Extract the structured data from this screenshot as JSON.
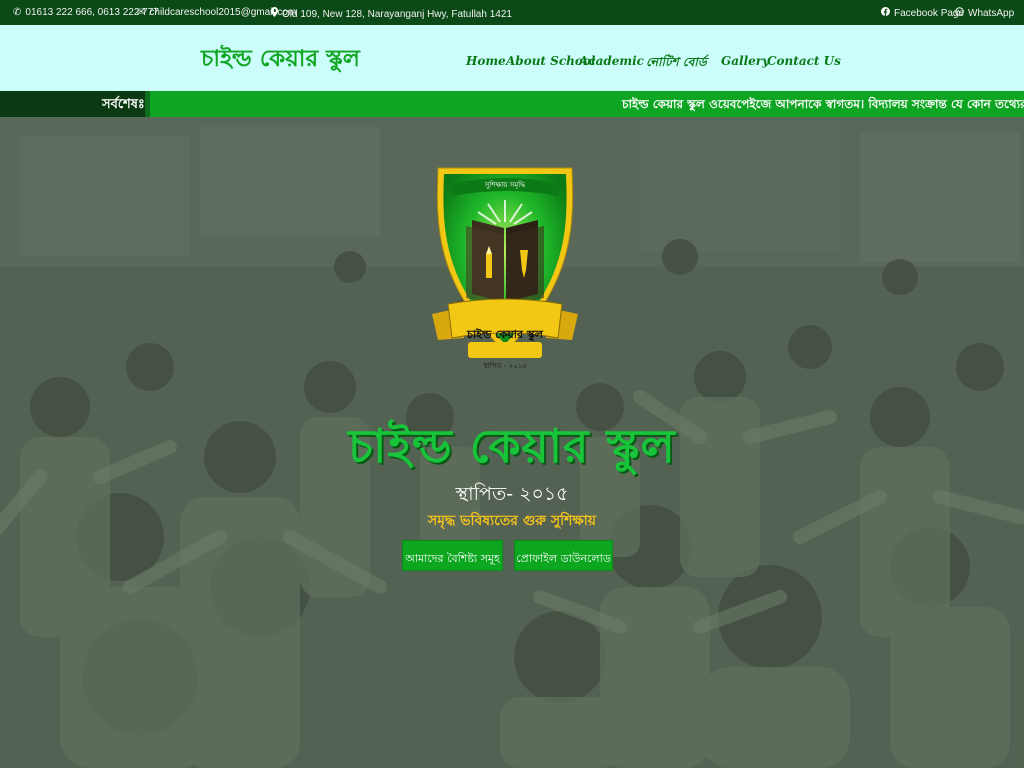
{
  "topbar": {
    "phone": "01613 222 666, 0613 222 777",
    "email": "childcareschool2015@gmail.com",
    "address": "Old 109, New 128, Narayanganj Hwy, Fatullah 1421",
    "facebook": "Facebook Page",
    "whatsapp": "WhatsApp",
    "icons": [
      "phone-icon",
      "mail-icon",
      "location-pin-icon",
      "facebook-icon",
      "whatsapp-icon"
    ]
  },
  "brand": {
    "name": "চাইল্ড কেয়ার স্কুল"
  },
  "nav": {
    "items": [
      "Home",
      "About School",
      "Academic",
      "নোটিশ বোর্ড",
      "Gallery",
      "Contact Us"
    ],
    "dropdown_icon": "chevron-down-icon"
  },
  "ticker": {
    "label": "সর্বশেষঃ",
    "text": "চাইল্ড কেয়ার স্কুল ওয়েবপেইজে আপনাকে স্বাগতম। বিদ্যালয় সংক্রান্ত যে কোন তথ্যের জন্য যোগাযোগ করুন"
  },
  "crest": {
    "motto": "সুশিক্ষায় সমৃদ্ধি",
    "banner": "চাইল্ড কেয়ার স্কুল",
    "founded": "স্থাপিত - ২০১৫"
  },
  "hero": {
    "title": "চাইল্ড কেয়ার স্কুল",
    "established": "স্থাপিত- ২০১৫",
    "tagline": "সমৃদ্ধ ভবিষ্যতের গুরু সুশিক্ষায়",
    "btn_features": "আমাদের বৈশিষ্ট্য সমূহ",
    "btn_profile": "প্রোফাইল ডাউনলোড"
  },
  "colors": {
    "topbar_bg": "#0b4a17",
    "navbar_bg": "#ccfdfb",
    "brand_green": "#12a625",
    "ticker_bg": "#0ea522",
    "tagline": "#f4c21a",
    "button_bg": "#0ca61f"
  }
}
